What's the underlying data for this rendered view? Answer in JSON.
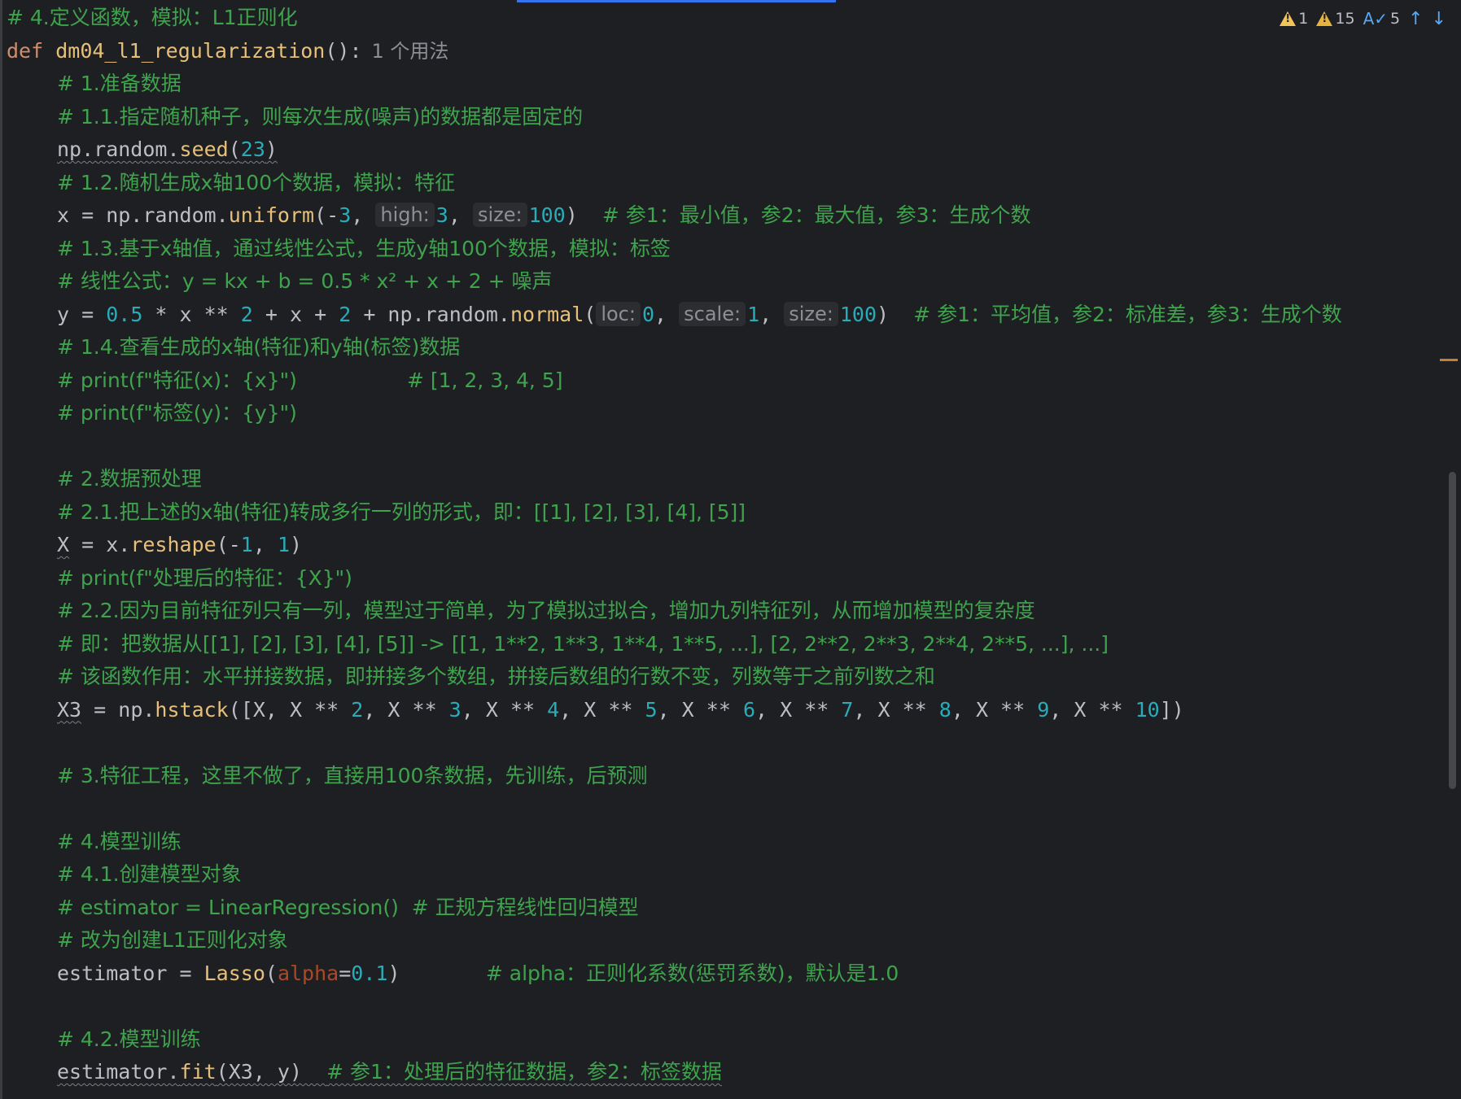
{
  "inspections": {
    "errors": "1",
    "warnings": "15",
    "typos": "5"
  },
  "colors": {
    "background": "#1e1f22",
    "comment": "#3fa34d",
    "keyword": "#cf8e6d",
    "function": "#56a8f5",
    "method": "#e6c07b",
    "number": "#2aacb8",
    "param": "#aa4926"
  },
  "code": {
    "l1": "# 4.定义函数，模拟：L1正则化",
    "l2_kw": "def",
    "l2_fn": "dm04_l1_regularization",
    "l2_rest": "():",
    "l2_usage": "1 个用法",
    "l3": "# 1.准备数据",
    "l4": "# 1.1.指定随机种子，则每次生成(噪声)的数据都是固定的",
    "l5_a": "np.random.",
    "l5_m": "seed",
    "l5_b": "(",
    "l5_n": "23",
    "l5_c": ")",
    "l6": "# 1.2.随机生成x轴100个数据，模拟：特征",
    "l7_a": "x = np.random.",
    "l7_m": "uniform",
    "l7_b": "(-",
    "l7_n1": "3",
    "l7_c": ", ",
    "l7_h1": "high:",
    "l7_n2": "3",
    "l7_d": ", ",
    "l7_h2": "size:",
    "l7_n3": "100",
    "l7_e": ")  ",
    "l7_cm": "# 参1：最小值，参2：最大值，参3：生成个数",
    "l8": "# 1.3.基于x轴值，通过线性公式，生成y轴100个数据，模拟：标签",
    "l9": "# 线性公式：y = kx + b = 0.5 * x² + x + 2 + 噪声",
    "l10_a": "y = ",
    "l10_n1": "0.5",
    "l10_b": " * x ** ",
    "l10_n2": "2",
    "l10_c": " + x + ",
    "l10_n3": "2",
    "l10_d": " + np.random.",
    "l10_m": "normal",
    "l10_e": "(",
    "l10_h1": "loc:",
    "l10_n4": "0",
    "l10_f": ", ",
    "l10_h2": "scale:",
    "l10_n5": "1",
    "l10_g": ", ",
    "l10_h3": "size:",
    "l10_n6": "100",
    "l10_h": ")  ",
    "l10_cm": "# 参1：平均值，参2：标准差，参3：生成个数",
    "l11": "# 1.4.查看生成的x轴(特征)和y轴(标签)数据",
    "l12": "# print(f\"特征(x)：{x}\")                 # [1, 2, 3, 4, 5]",
    "l13": "# print(f\"标签(y)：{y}\")",
    "l15": "# 2.数据预处理",
    "l16": "# 2.1.把上述的x轴(特征)转成多行一列的形式，即：[[1], [2], [3], [4], [5]]",
    "l17_v": "X",
    "l17_a": " = x.",
    "l17_m": "reshape",
    "l17_b": "(-",
    "l17_n1": "1",
    "l17_c": ", ",
    "l17_n2": "1",
    "l17_d": ")",
    "l18": "# print(f\"处理后的特征：{X}\")",
    "l19": "# 2.2.因为目前特征列只有一列，模型过于简单，为了模拟过拟合，增加九列特征列，从而增加模型的复杂度",
    "l20": "# 即：把数据从[[1], [2], [3], [4], [5]] -> [[1, 1**2, 1**3, 1**4, 1**5, ...], [2, 2**2, 2**3, 2**4, 2**5, ...], ...]",
    "l21": "# 该函数作用：水平拼接数据，即拼接多个数组，拼接后数组的行数不变，列数等于之前列数之和",
    "l22_v": "X3",
    "l22_a": " = np.",
    "l22_m": "hstack",
    "l22_b": "([X, X ** ",
    "l22_n2": "2",
    "l22_c": ", X ** ",
    "l22_n3": "3",
    "l22_d": ", X ** ",
    "l22_n4": "4",
    "l22_e": ", X ** ",
    "l22_n5": "5",
    "l22_f": ", X ** ",
    "l22_n6": "6",
    "l22_g": ", X ** ",
    "l22_n7": "7",
    "l22_h": ", X ** ",
    "l22_n8": "8",
    "l22_i": ", X ** ",
    "l22_n9": "9",
    "l22_j": ", X ** ",
    "l22_n10": "10",
    "l22_k": "])",
    "l24": "# 3.特征工程，这里不做了，直接用100条数据，先训练，后预测",
    "l26": "# 4.模型训练",
    "l27": "# 4.1.创建模型对象",
    "l28": "# estimator = LinearRegression()  # 正规方程线性回归模型",
    "l29": "# 改为创建L1正则化对象",
    "l30_a": "estimator = ",
    "l30_m": "Lasso",
    "l30_b": "(",
    "l30_p": "alpha",
    "l30_c": "=",
    "l30_n": "0.1",
    "l30_d": ")       ",
    "l30_cm": "# alpha：正则化系数(惩罚系数)，默认是1.0",
    "l32": "# 4.2.模型训练",
    "l33_a": "estimator.",
    "l33_m": "fit",
    "l33_b": "(X3, y)  ",
    "l33_cm": "# 参1：处理后的特征数据，参2：标签数据"
  }
}
